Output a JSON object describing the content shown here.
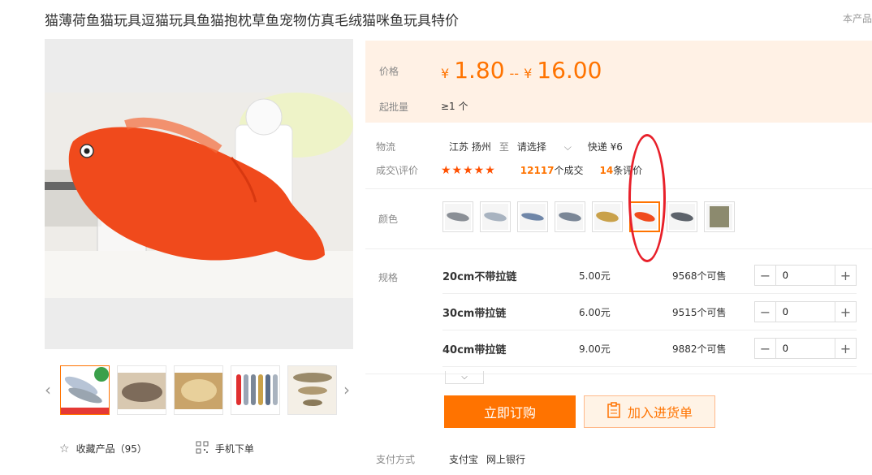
{
  "product": {
    "title": "猫薄荷鱼猫玩具逗猫玩具鱼猫抱枕草鱼宠物仿真毛绒猫咪鱼玩具特价",
    "top_right": "本产品"
  },
  "gallery": {
    "prev_icon": "chevron-left-icon",
    "next_icon": "chevron-right-icon",
    "thumbnail_badge": "猫薄荷",
    "thumbnail_caption": "加薄荷猫玩具  超值超值"
  },
  "actions": {
    "favorite_label": "收藏产品（95）",
    "mobile_label": "手机下单"
  },
  "price": {
    "label": "价格",
    "currency": "¥",
    "min": "1.80",
    "separator": "--",
    "max": "16.00",
    "moq_label": "起批量",
    "moq_value": "≥1 个"
  },
  "logistics": {
    "label": "物流",
    "origin": "江苏 扬州",
    "to": "至",
    "destination": "请选择",
    "shipping": "快递 ¥6"
  },
  "reviews": {
    "label": "成交\\评价",
    "stars": "★★★★★",
    "deals_count": "12117",
    "deals_suffix": "个成交",
    "reviews_count": "14",
    "reviews_suffix": "条评价"
  },
  "colors": {
    "label": "颜色",
    "swatches": [
      "gray-fish",
      "silver-fish",
      "blue-fish",
      "striped-fish",
      "golden-fish",
      "red-fish",
      "mottled-fish",
      "catnip-bag"
    ],
    "selected_index": 5
  },
  "specs": {
    "label": "规格",
    "rows": [
      {
        "name": "20cm不带拉链",
        "price": "5.00元",
        "stock": "9568个可售",
        "qty": "0"
      },
      {
        "name": "30cm带拉链",
        "price": "6.00元",
        "stock": "9515个可售",
        "qty": "0"
      },
      {
        "name": "40cm带拉链",
        "price": "9.00元",
        "stock": "9882个可售",
        "qty": "0"
      }
    ]
  },
  "buttons": {
    "buy": "立即订购",
    "cart": "加入进货单"
  },
  "payment": {
    "label": "支付方式",
    "method1": "支付宝",
    "method2": "网上银行"
  },
  "colors_palette": {
    "accent": "#ff7300",
    "price_bg": "#fff1e5",
    "highlight": "#e8202a"
  }
}
